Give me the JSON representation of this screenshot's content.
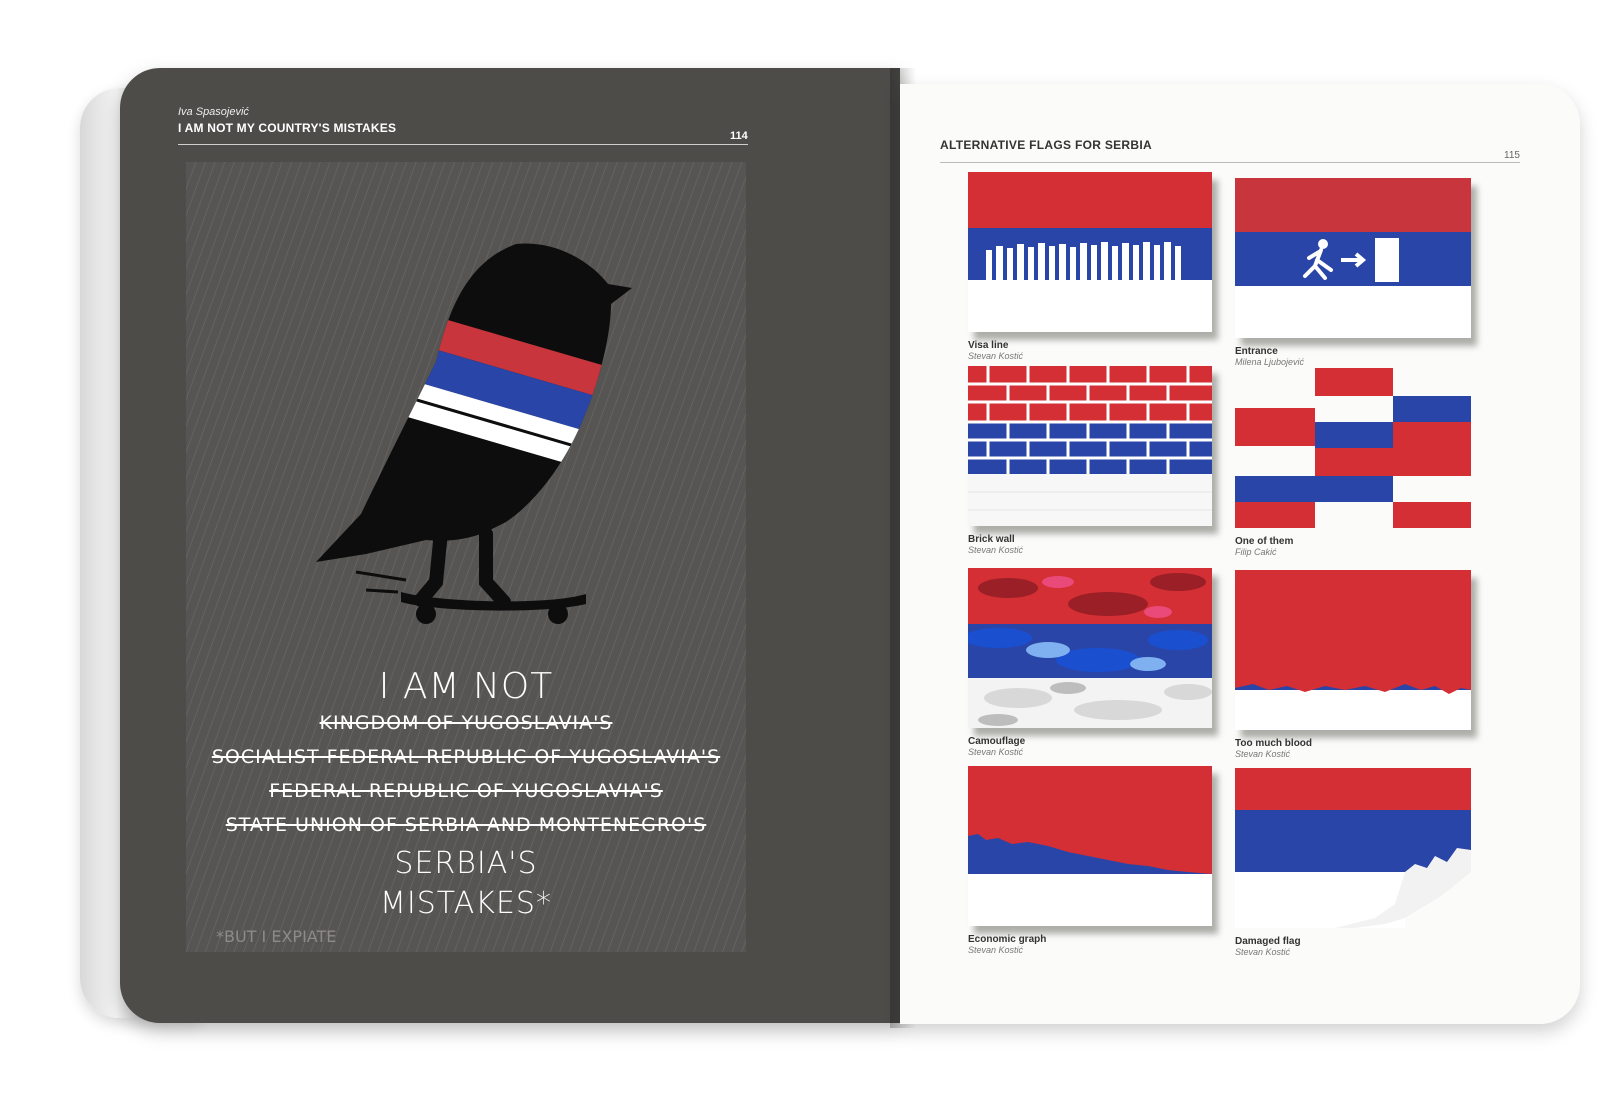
{
  "left_page": {
    "author": "Iva Spasojević",
    "title": "I AM NOT MY COUNTRY'S MISTAKES",
    "page_number": "114",
    "poster": {
      "line1": "I AM NOT",
      "struck_lines": [
        "KINGDOM OF YUGOSLAVIA'S",
        "SOCIALIST FEDERAL REPUBLIC OF YUGOSLAVIA'S",
        "FEDERAL REPUBLIC OF YUGOSLAVIA'S",
        "STATE UNION OF SERBIA AND MONTENEGRO'S"
      ],
      "line_serbia": "SERBIA'S",
      "line_mistakes": "MISTAKES*",
      "footnote": "*BUT I EXPIATE"
    }
  },
  "right_page": {
    "title": "ALTERNATIVE FLAGS FOR SERBIA",
    "page_number": "115",
    "flags": [
      {
        "name": "Visa line",
        "author": "Stevan Kostić"
      },
      {
        "name": "Entrance",
        "author": "Milena Ljubojević"
      },
      {
        "name": "Brick wall",
        "author": "Stevan Kostić"
      },
      {
        "name": "One of them",
        "author": "Filip Cakić"
      },
      {
        "name": "Camouflage",
        "author": "Stevan Kostić"
      },
      {
        "name": "Too much blood",
        "author": "Stevan Kostić"
      },
      {
        "name": "Economic graph",
        "author": "Stevan Kostić"
      },
      {
        "name": "Damaged flag",
        "author": "Stevan Kostić"
      }
    ]
  },
  "colors": {
    "red": "#d32f35",
    "blue": "#2a45a8",
    "white": "#ffffff",
    "dark_page": "#4e4c49"
  }
}
